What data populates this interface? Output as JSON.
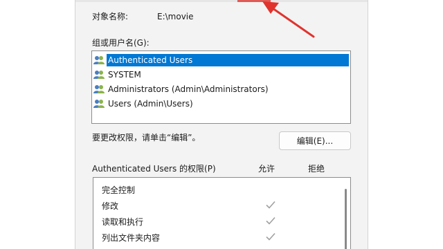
{
  "object": {
    "label": "对象名称:",
    "value": "E:\\movie"
  },
  "groups": {
    "label": "组或用户名(G):",
    "items": [
      {
        "name": "Authenticated Users",
        "selected": true
      },
      {
        "name": "SYSTEM",
        "selected": false
      },
      {
        "name": "Administrators (Admin\\Administrators)",
        "selected": false
      },
      {
        "name": "Users (Admin\\Users)",
        "selected": false
      }
    ]
  },
  "hint": "要更改权限，请单击“编辑”。",
  "edit_button": "编辑(E)...",
  "permissions": {
    "header": "Authenticated Users 的权限(P)",
    "allow_header": "允许",
    "deny_header": "拒绝",
    "rows": [
      {
        "name": "完全控制",
        "allow": false
      },
      {
        "name": "修改",
        "allow": true
      },
      {
        "name": "读取和执行",
        "allow": true
      },
      {
        "name": "列出文件夹内容",
        "allow": true
      }
    ]
  },
  "colors": {
    "selection": "#0078d4",
    "annotation": "#e0332e"
  }
}
